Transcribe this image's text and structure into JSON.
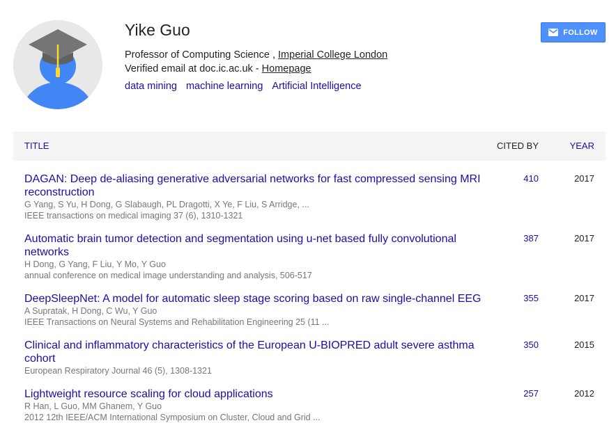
{
  "profile": {
    "name": "Yike Guo",
    "position": "Professor of Computing Science",
    "separator": " , ",
    "institution": "Imperial College London",
    "verified": "Verified email at doc.ic.ac.uk",
    "dash": " - ",
    "homepage": "Homepage",
    "interests": [
      "data mining",
      "machine learning",
      "Artificial Intelligence"
    ]
  },
  "follow_button": {
    "label": "FOLLOW",
    "icon": "mail-icon"
  },
  "table": {
    "col_title": "TITLE",
    "col_cited": "CITED BY",
    "col_year": "YEAR",
    "rows": [
      {
        "title": "DAGAN: Deep de-aliasing generative adversarial networks for fast compressed sensing MRI reconstruction",
        "authors": "G Yang, S Yu, H Dong, G Slabaugh, PL Dragotti, X Ye, F Liu, S Arridge, ...",
        "venue": "IEEE transactions on medical imaging 37 (6), 1310-1321",
        "cited": "410",
        "year": "2017"
      },
      {
        "title": "Automatic brain tumor detection and segmentation using u-net based fully convolutional networks",
        "authors": "H Dong, G Yang, F Liu, Y Mo, Y Guo",
        "venue": "annual conference on medical image understanding and analysis, 506-517",
        "cited": "387",
        "year": "2017"
      },
      {
        "title": "DeepSleepNet: A model for automatic sleep stage scoring based on raw single-channel EEG",
        "authors": "A Supratak, H Dong, C Wu, Y Guo",
        "venue": "IEEE Transactions on Neural Systems and Rehabilitation Engineering 25 (11 ...",
        "cited": "355",
        "year": "2017"
      },
      {
        "title": "Clinical and inflammatory characteristics of the European U-BIOPRED adult severe asthma cohort",
        "authors": "",
        "venue": "European Respiratory Journal 46 (5), 1308-1321",
        "cited": "350",
        "year": "2015"
      },
      {
        "title": "Lightweight resource scaling for cloud applications",
        "authors": "R Han, L Guo, MM Ghanem, Y Guo",
        "venue": "2012 12th IEEE/ACM International Symposium on Cluster, Cloud and Grid ...",
        "cited": "257",
        "year": "2012"
      }
    ]
  },
  "colors": {
    "link": "#1a0dab",
    "button": "#4d90fe",
    "header_bg": "#f5f5f5",
    "avatar_body": "#4285f4",
    "cap": "#757575",
    "tassel": "#fdd835"
  }
}
